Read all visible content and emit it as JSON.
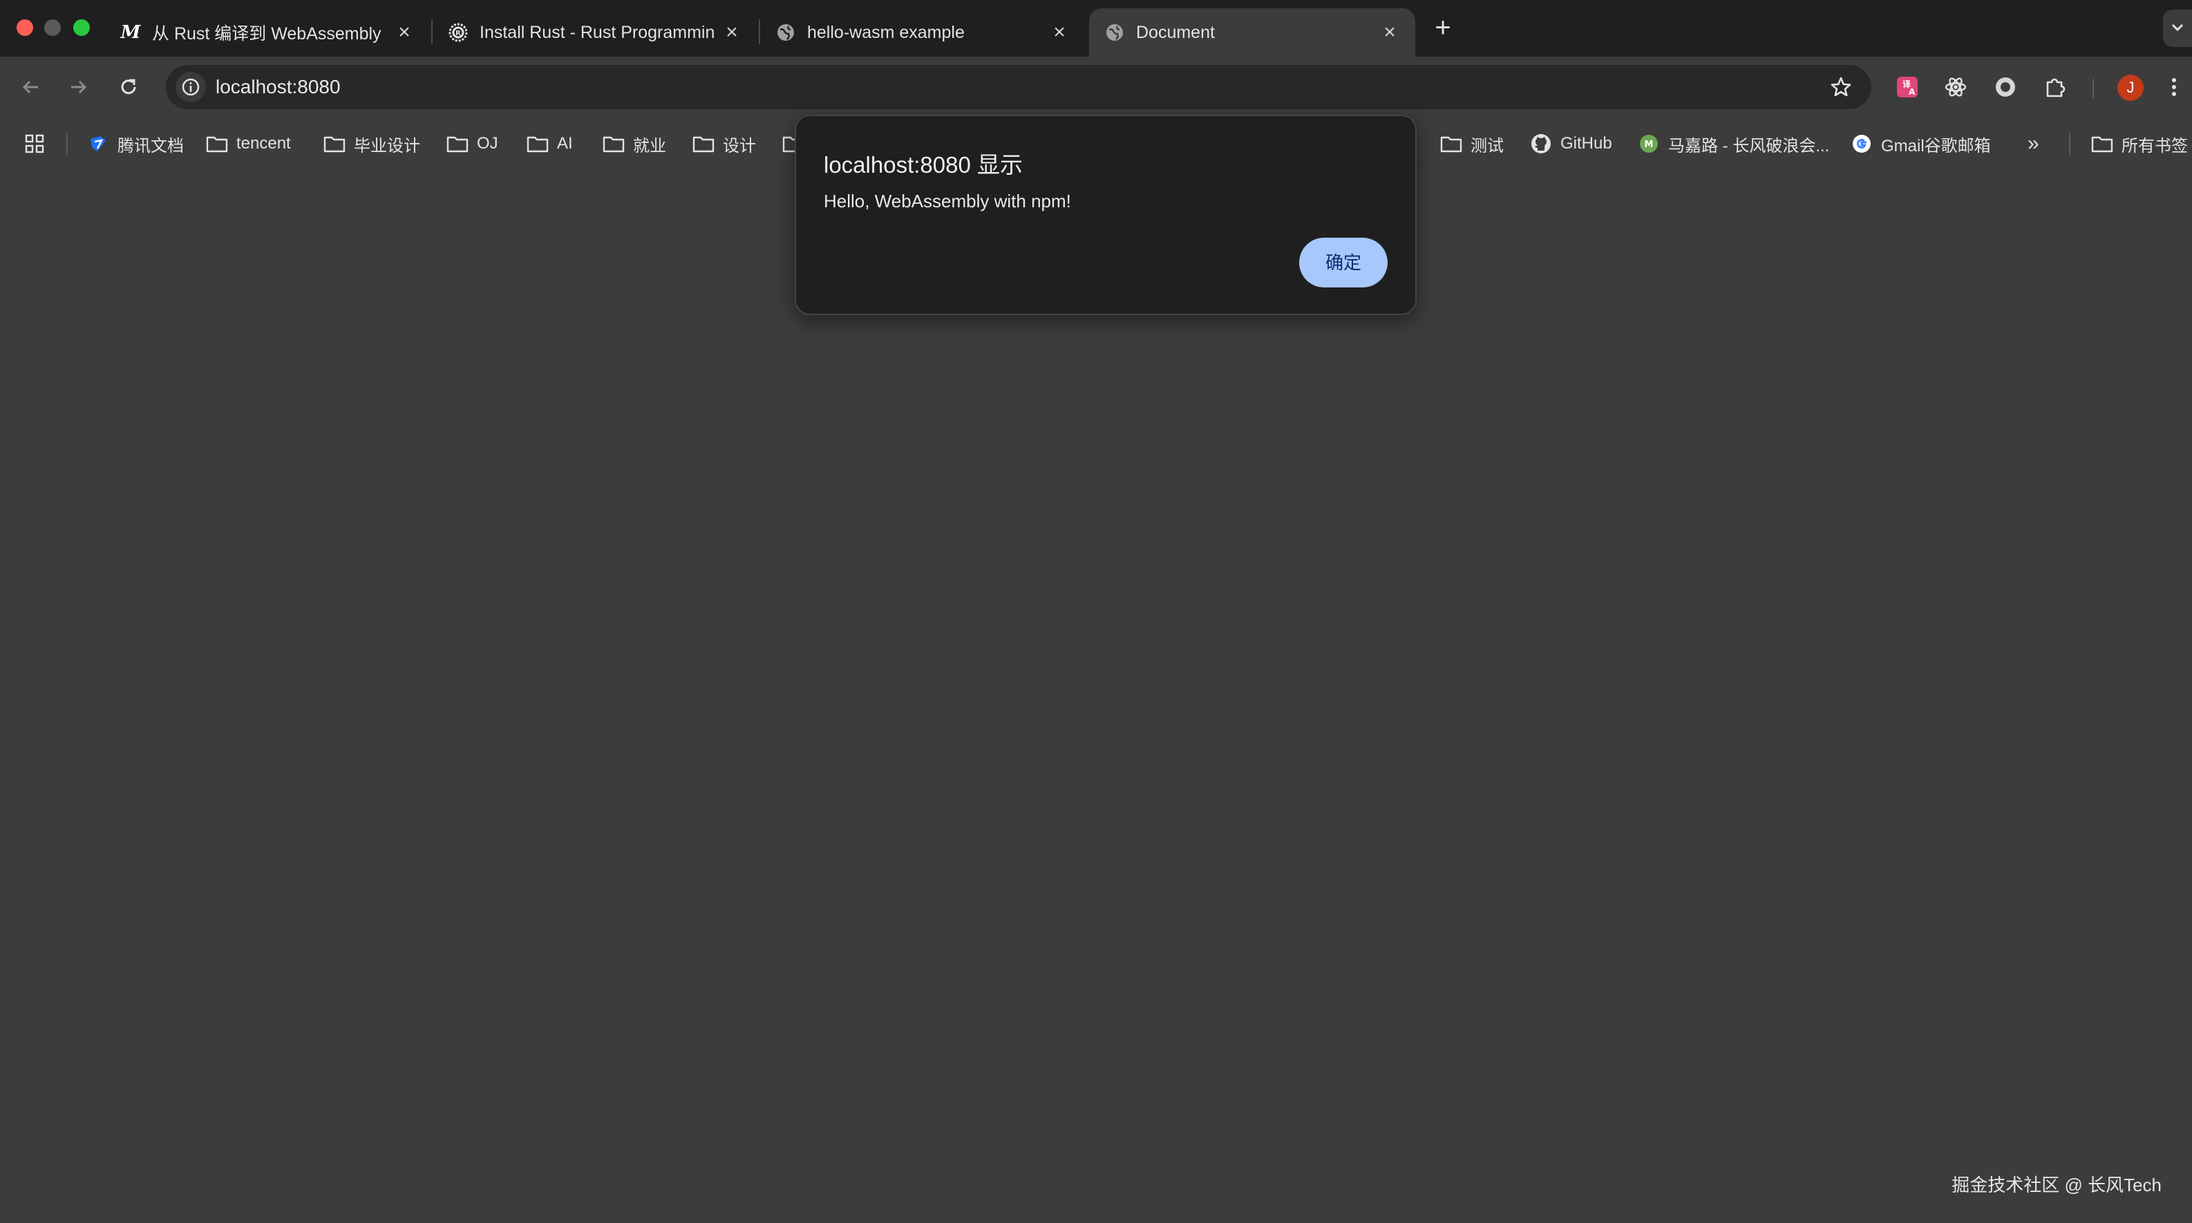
{
  "tabs": [
    {
      "title": "从 Rust 编译到 WebAssembly",
      "favicon": "mdn-logo-icon"
    },
    {
      "title": "Install Rust - Rust Programming Language",
      "favicon": "rust-logo-icon"
    },
    {
      "title": "hello-wasm example",
      "favicon": "globe-icon"
    },
    {
      "title": "Document",
      "favicon": "globe-icon",
      "active": true
    }
  ],
  "mdn_favicon_text": "M",
  "toolbar": {
    "url": "localhost:8080",
    "avatar_letter": "J"
  },
  "bookmarks": {
    "items": [
      {
        "label": "腾讯文档",
        "icon": "tencent-docs-icon"
      },
      {
        "label": "tencent",
        "icon": "folder-icon"
      },
      {
        "label": "毕业设计",
        "icon": "folder-icon"
      },
      {
        "label": "OJ",
        "icon": "folder-icon"
      },
      {
        "label": "AI",
        "icon": "folder-icon"
      },
      {
        "label": "就业",
        "icon": "folder-icon"
      },
      {
        "label": "设计",
        "icon": "folder-icon"
      },
      {
        "label": "测试",
        "icon": "folder-icon"
      },
      {
        "label": "GitHub",
        "icon": "github-icon"
      },
      {
        "label": "马嘉路 - 长风破浪会...",
        "icon": "site-icon"
      },
      {
        "label": "Gmail谷歌邮箱",
        "icon": "google-icon"
      }
    ],
    "overflow": "»",
    "all_bookmarks": "所有书签"
  },
  "dialog": {
    "title": "localhost:8080 显示",
    "message": "Hello, WebAssembly with npm!",
    "ok_label": "确定"
  },
  "watermark": "掘金技术社区 @ 长风Tech",
  "colors": {
    "tabstrip": "#1f1f1f",
    "toolbar": "#3c3c3c",
    "dialog_bg": "#1f1f1f",
    "ok_button": "#a8c7fa",
    "avatar": "#c53a1b"
  }
}
